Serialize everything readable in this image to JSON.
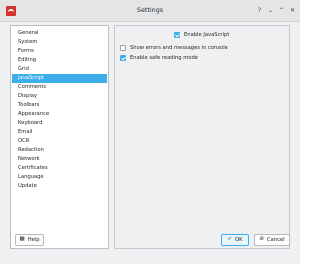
{
  "window": {
    "title": "Settings"
  },
  "titlebar_buttons": {
    "help": "?",
    "minimize": "⌄",
    "maximize": "⌃",
    "close": "✕"
  },
  "sidebar": {
    "items": [
      {
        "label": "General"
      },
      {
        "label": "System"
      },
      {
        "label": "Forms"
      },
      {
        "label": "Editing"
      },
      {
        "label": "Grid"
      },
      {
        "label": "JavaScript",
        "selected": true
      },
      {
        "label": "Comments"
      },
      {
        "label": "Display"
      },
      {
        "label": "Toolbars"
      },
      {
        "label": "Appearance"
      },
      {
        "label": "Keyboard"
      },
      {
        "label": "Email"
      },
      {
        "label": "OCR"
      },
      {
        "label": "Redaction"
      },
      {
        "label": "Network"
      },
      {
        "label": "Certificates"
      },
      {
        "label": "Language"
      },
      {
        "label": "Update"
      }
    ]
  },
  "javascript_settings": {
    "enable_javascript": {
      "label": "Enable JavaScript",
      "checked": true
    },
    "show_errors": {
      "label": "Show errors and  messages in console",
      "checked": false
    },
    "safe_reading_mode": {
      "label": "Enable safe reading mode",
      "checked": true
    }
  },
  "footer": {
    "help_label": "Help",
    "ok_label": "OK",
    "cancel_label": "Cancel",
    "help_icon": "help-icon",
    "ok_icon": "checkmark-icon",
    "cancel_icon": "cancel-icon"
  },
  "colors": {
    "accent": "#3daee9",
    "app_icon": "#d6332c"
  }
}
